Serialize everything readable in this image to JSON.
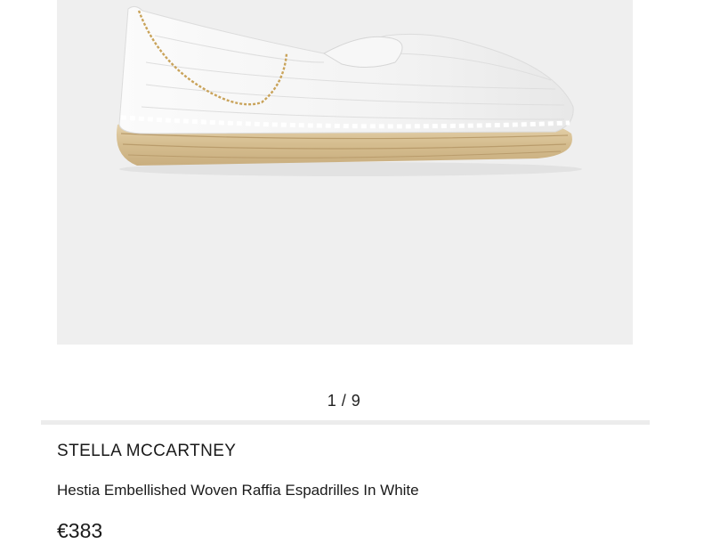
{
  "gallery": {
    "current": "1",
    "separator": " / ",
    "total": "9",
    "image_alt": "white woven espadrille with gold chain"
  },
  "product": {
    "brand": "STELLA MCCARTNEY",
    "name": "Hestia Embellished Woven Raffia Espadrilles In White",
    "price": "€383"
  },
  "colors": {
    "image_background": "#efefef",
    "divider": "#ececec",
    "text": "#1a1a1a"
  }
}
